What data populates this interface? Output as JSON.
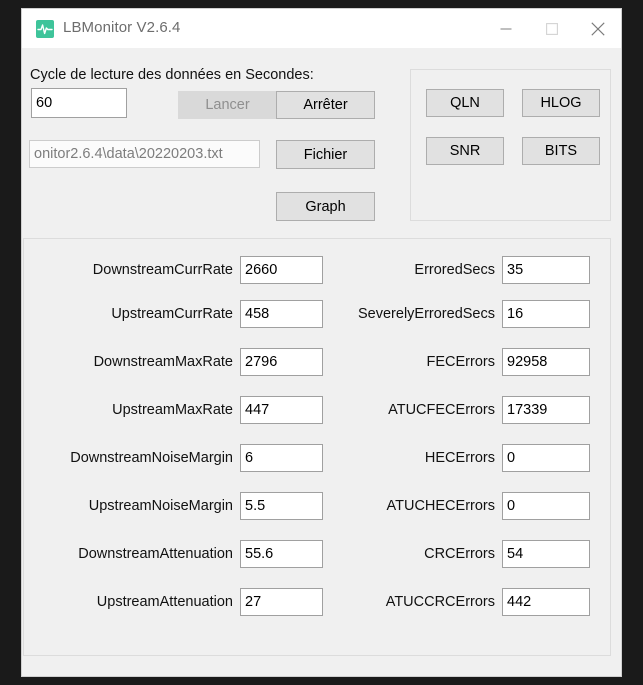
{
  "window": {
    "title": "LBMonitor V2.6.4",
    "icon": "pulse-waveform-icon",
    "accent_color": "#3ec49a",
    "background_color": "#f0f0f0",
    "controls": {
      "minimize": "minimize-icon",
      "maximize": "maximize-icon",
      "close": "close-icon"
    }
  },
  "control_panel": {
    "cycle_label": "Cycle de lecture des données en Secondes:",
    "cycle_value": "60",
    "file_path_value": "onitor2.6.4\\data\\20220203.txt",
    "buttons": {
      "start": "Lancer",
      "stop": "Arrêter",
      "file": "Fichier",
      "graph": "Graph"
    },
    "start_disabled": true
  },
  "diagnostics_panel": {
    "buttons": [
      "QLN",
      "HLOG",
      "SNR",
      "BITS"
    ]
  },
  "stats": {
    "left": [
      {
        "label": "DownstreamCurrRate",
        "value": "2660"
      },
      {
        "label": "UpstreamCurrRate",
        "value": "458"
      },
      {
        "label": "DownstreamMaxRate",
        "value": "2796"
      },
      {
        "label": "UpstreamMaxRate",
        "value": "447"
      },
      {
        "label": "DownstreamNoiseMargin",
        "value": "6"
      },
      {
        "label": "UpstreamNoiseMargin",
        "value": "5.5"
      },
      {
        "label": "DownstreamAttenuation",
        "value": "55.6"
      },
      {
        "label": "UpstreamAttenuation",
        "value": "27"
      }
    ],
    "right": [
      {
        "label": "ErroredSecs",
        "value": "35"
      },
      {
        "label": "SeverelyErroredSecs",
        "value": "16"
      },
      {
        "label": "FECErrors",
        "value": "92958"
      },
      {
        "label": "ATUCFECErrors",
        "value": "17339"
      },
      {
        "label": "HECErrors",
        "value": "0"
      },
      {
        "label": "ATUCHECErrors",
        "value": "0"
      },
      {
        "label": "CRCErrors",
        "value": "54"
      },
      {
        "label": "ATUCCRCErrors",
        "value": "442"
      }
    ]
  }
}
